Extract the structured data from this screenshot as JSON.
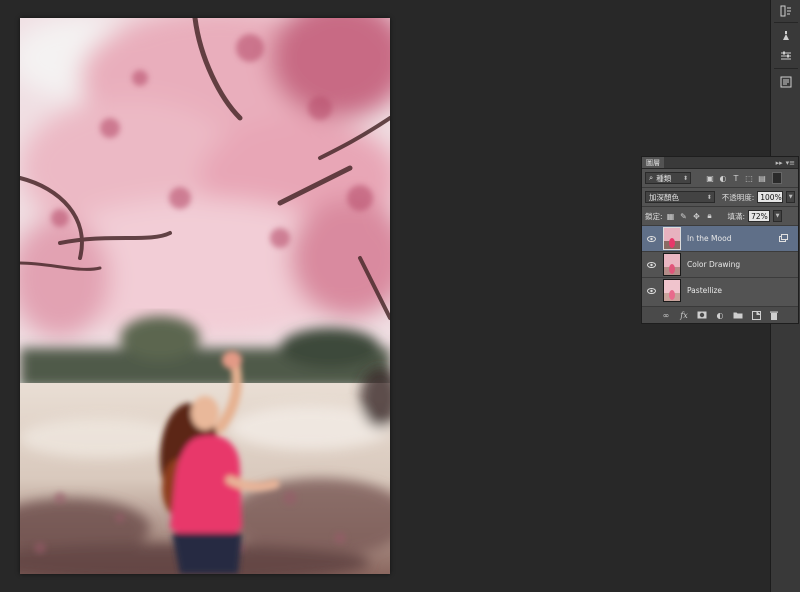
{
  "layers_panel": {
    "tab_title": "圖層",
    "filter": {
      "value": "種類"
    },
    "blend_mode": {
      "value": "加深顏色"
    },
    "opacity": {
      "label": "不透明度:",
      "value": "100%"
    },
    "lock": {
      "label": "鎖定:"
    },
    "fill": {
      "label": "填滿:",
      "value": "72%"
    },
    "layers": [
      {
        "name": "In the Mood",
        "selected": true,
        "smart_object": true,
        "visible": true
      },
      {
        "name": "Color Drawing",
        "selected": false,
        "smart_object": false,
        "visible": true
      },
      {
        "name": "Pastellize",
        "selected": false,
        "smart_object": false,
        "visible": true
      }
    ],
    "footer_icons": [
      "link-icon",
      "fx-icon",
      "mask-icon",
      "adjustment-icon",
      "folder-icon",
      "new-layer-icon",
      "trash-icon"
    ]
  },
  "dock_icons": [
    "history-icon",
    "brush-preset-icon",
    "adjustments-icon",
    "properties-icon"
  ],
  "colors": {
    "workspace": "#282828",
    "panel": "#535353",
    "selected_layer": "#5f6f88",
    "blossom_pink": "#e7a9b6",
    "shirt_magenta": "#e8386a"
  }
}
